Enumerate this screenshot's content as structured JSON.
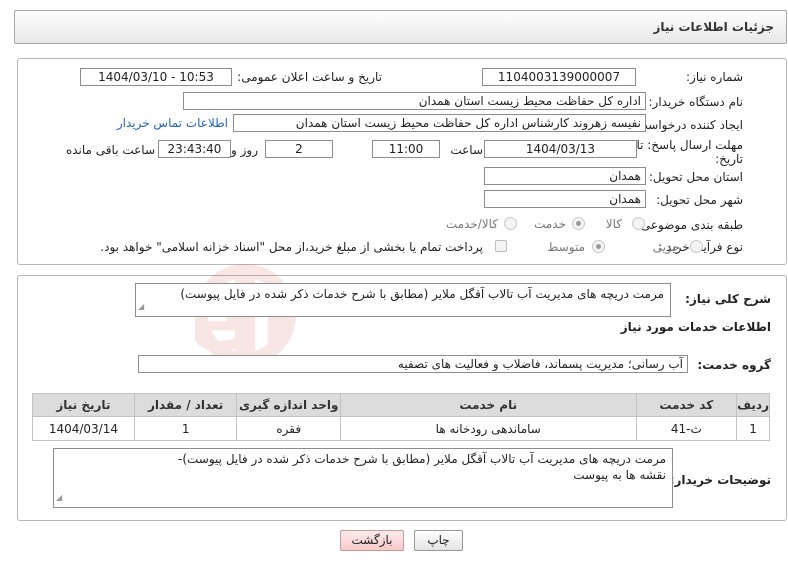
{
  "header": {
    "title": "جزئیات اطلاعات نیاز"
  },
  "form": {
    "need_number": {
      "label": "شماره نیاز:",
      "value": "1104003139000007"
    },
    "announce_datetime": {
      "label": "تاریخ و ساعت اعلان عمومی:",
      "value": "1404/03/10 - 10:53"
    },
    "buyer_org": {
      "label": "نام دستگاه خریدار:",
      "value": "اداره کل حفاظت محیط زیست استان همدان"
    },
    "requester": {
      "label": "ایجاد کننده درخواست:",
      "value": "نفیسه زهروند کارشناس  اداره کل حفاظت محیط زیست استان همدان",
      "contact_link": "اطلاعات تماس خریدار"
    },
    "deadline": {
      "label": "مهلت ارسال پاسخ: تا تاریخ:",
      "date": "1404/03/13",
      "time_label": "ساعت",
      "time": "11:00",
      "days": "2",
      "days_label": "روز و",
      "remaining": "23:43:40",
      "remaining_label": "ساعت باقی مانده"
    },
    "province": {
      "label": "استان محل تحویل:",
      "value": "همدان"
    },
    "city": {
      "label": "شهر محل تحویل:",
      "value": "همدان"
    },
    "category": {
      "label": "طبقه بندی موضوعی:",
      "options": [
        "کالا",
        "خدمت",
        "کالا/خدمت"
      ],
      "selected": "خدمت"
    },
    "process": {
      "label": "نوع فرآیند خرید :",
      "options": [
        "جزیی",
        "متوسط"
      ],
      "selected": "متوسط",
      "payment_note": "پرداخت تمام یا بخشی از مبلغ خرید،از محل \"اسناد خزانه اسلامی\" خواهد بود."
    }
  },
  "summary": {
    "label": "شرح کلی نیاز:",
    "value": "مرمت دریچه های مدیریت آب تالاب آقگل ملایر (مطابق با شرح خدمات ذکر شده در فایل پیوست)"
  },
  "services": {
    "section_title": "اطلاعات خدمات مورد نیاز",
    "group_label": "گروه خدمت:",
    "group_value": "آب رسانی؛ مدیریت پسماند، فاضلاب و فعالیت های تصفیه",
    "columns": [
      "ردیف",
      "کد خدمت",
      "نام خدمت",
      "واحد اندازه گیری",
      "تعداد / مقدار",
      "تاریخ نیاز"
    ],
    "rows": [
      {
        "row": "1",
        "code": "ث-41",
        "name": "ساماندهی رودخانه ها",
        "unit": "فقره",
        "qty": "1",
        "date": "1404/03/14"
      }
    ]
  },
  "buyer_notes": {
    "label": "توضیحات خریدار:",
    "line1": "مرمت دریچه های مدیریت آب تالاب آقگل ملایر (مطابق با شرح خدمات ذکر شده در فایل پیوست)-",
    "line2": "نقشه ها به پیوست"
  },
  "buttons": {
    "print": "چاپ",
    "back": "بازگشت"
  },
  "watermark": {
    "text": "AriaTender.neT"
  }
}
